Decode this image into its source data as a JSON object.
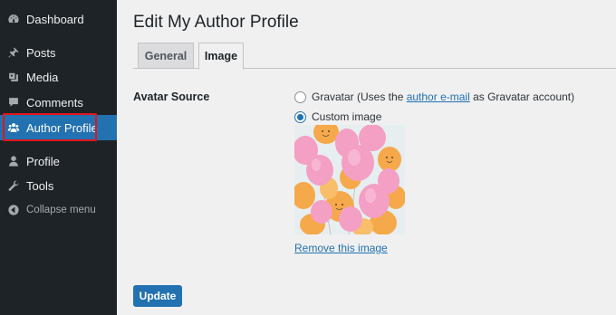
{
  "sidebar": {
    "items": [
      {
        "label": "Dashboard",
        "icon": "dashboard-icon"
      },
      {
        "label": "Posts",
        "icon": "pin-icon"
      },
      {
        "label": "Media",
        "icon": "media-icon"
      },
      {
        "label": "Comments",
        "icon": "comment-icon"
      },
      {
        "label": "Author Profile",
        "icon": "users-icon",
        "current": true
      },
      {
        "label": "Profile",
        "icon": "user-icon"
      },
      {
        "label": "Tools",
        "icon": "wrench-icon"
      },
      {
        "label": "Collapse menu",
        "icon": "collapse-icon"
      }
    ],
    "colors": {
      "background": "#1d2327",
      "current": "#2271b1",
      "highlight_border": "#e3151a"
    }
  },
  "main": {
    "title": "Edit My Author Profile",
    "tabs": [
      {
        "label": "General",
        "active": false
      },
      {
        "label": "Image",
        "active": true
      }
    ],
    "avatar_source": {
      "label": "Avatar Source",
      "options": [
        {
          "label_prefix": "Gravatar (Uses the ",
          "link": "author e-mail",
          "label_suffix": " as Gravatar account)",
          "checked": false
        },
        {
          "label": "Custom image",
          "checked": true
        }
      ],
      "image_alt": "pink and orange balloons",
      "remove_link": "Remove this image"
    },
    "update_button": "Update",
    "colors": {
      "accent": "#2271b1"
    }
  }
}
